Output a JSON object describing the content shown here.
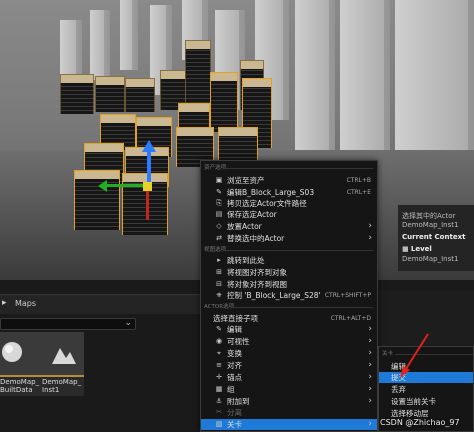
{
  "bottom": {
    "path_label": "Maps",
    "assets": [
      {
        "label": "DemoMap_\nBuiltData"
      },
      {
        "label": "DemoMap_\nInst1"
      }
    ]
  },
  "details": {
    "line1": "选择其中的Actor",
    "line2": "DemoMap_Inst1",
    "context_title": "Current Context",
    "level_label": "Level",
    "level_value": "DemoMap_Inst1"
  },
  "context_menu": {
    "section_asset": "资产选项",
    "asset_items": [
      {
        "icon": "browse-icon",
        "glyph": "▣",
        "label": "浏览至资产",
        "shortcut": "CTRL+B"
      },
      {
        "icon": "edit-icon",
        "glyph": "✎",
        "label": "编辑B_Block_Large_S03",
        "shortcut": "CTRL+E"
      },
      {
        "icon": "copy-icon",
        "glyph": "⎘",
        "label": "拷贝选定Actor文件路径",
        "shortcut": ""
      },
      {
        "icon": "save-icon",
        "glyph": "▤",
        "label": "保存选定Actor",
        "shortcut": ""
      },
      {
        "icon": "place-icon",
        "glyph": "◇",
        "label": "放置Actor",
        "shortcut": "",
        "submenu": true
      },
      {
        "icon": "replace-icon",
        "glyph": "⇄",
        "label": "替换选中的Actor",
        "shortcut": "",
        "submenu": true
      }
    ],
    "section_view": "视图选项",
    "view_items": [
      {
        "icon": "jump-icon",
        "glyph": "▸",
        "label": "跳转到此处",
        "shortcut": ""
      },
      {
        "icon": "align-view-icon",
        "glyph": "⊞",
        "label": "将视图对齐到对象",
        "shortcut": ""
      },
      {
        "icon": "align-object-icon",
        "glyph": "⊟",
        "label": "将对象对齐到视图",
        "shortcut": ""
      },
      {
        "icon": "pilot-icon",
        "glyph": "⎈",
        "label": "控制 'B_Block_Large_S28'",
        "shortcut": "CTRL+SHIFT+P"
      }
    ],
    "section_actor": "ACTOR选项",
    "actor_items": [
      {
        "icon": "",
        "glyph": "",
        "label": "选择直接子项",
        "shortcut": "CTRL+ALT+D"
      },
      {
        "icon": "edit2-icon",
        "glyph": "✎",
        "label": "编辑",
        "shortcut": "",
        "submenu": true
      },
      {
        "icon": "visibility-icon",
        "glyph": "◉",
        "label": "可视性",
        "shortcut": "",
        "submenu": true
      },
      {
        "icon": "transform-icon",
        "glyph": "⌖",
        "label": "变换",
        "shortcut": "",
        "submenu": true
      },
      {
        "icon": "align-icon",
        "glyph": "≡",
        "label": "对齐",
        "shortcut": "",
        "submenu": true
      },
      {
        "icon": "pivot-icon",
        "glyph": "✛",
        "label": "锚点",
        "shortcut": "",
        "submenu": true
      },
      {
        "icon": "group-icon",
        "glyph": "▦",
        "label": "组",
        "shortcut": "",
        "submenu": true
      },
      {
        "icon": "attach-icon",
        "glyph": "⚓",
        "label": "附加到",
        "shortcut": "",
        "submenu": true
      },
      {
        "icon": "detach-icon",
        "glyph": "✂",
        "label": "分离",
        "shortcut": "",
        "disabled": true
      },
      {
        "icon": "level-icon",
        "glyph": "▧",
        "label": "关卡",
        "shortcut": "",
        "submenu": true,
        "highlighted": true
      }
    ]
  },
  "submenu": {
    "section": "关卡",
    "items": [
      {
        "label": "编辑"
      },
      {
        "label": "提交",
        "highlighted": true
      },
      {
        "label": "丢弃"
      },
      {
        "label": "设置当前关卡"
      },
      {
        "label": "选择移动层"
      }
    ]
  },
  "watermark": "CSDN @Zhichao_97",
  "colors": {
    "accent": "#1e7ad6",
    "selection": "#e4a21e",
    "menu_bg": "#151515",
    "arrow": "#e0221a"
  }
}
